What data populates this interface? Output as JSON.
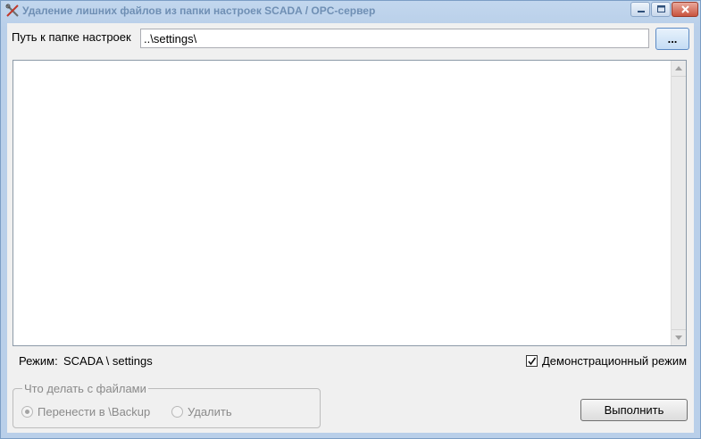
{
  "window": {
    "title": "Удаление лишних файлов из папки настроек SCADA / OPC-сервер",
    "icon": "tools-icon"
  },
  "path": {
    "label": "Путь к папке настроек",
    "value": "..\\settings\\",
    "browse_label": "..."
  },
  "mode": {
    "label": "Режим:",
    "value": "SCADA \\ settings"
  },
  "demo_mode": {
    "label": "Демонстрационный режим",
    "checked": true
  },
  "files_group": {
    "title": "Что делать с файлами",
    "options": [
      {
        "label": "Перенести в \\Backup",
        "selected": true,
        "enabled": false
      },
      {
        "label": "Удалить",
        "selected": false,
        "enabled": false
      }
    ]
  },
  "run_button": {
    "label": "Выполнить"
  },
  "colors": {
    "frame": "#b9cfe9",
    "title_text": "#6f8fb4",
    "close_button": "#c9543f",
    "client_bg": "#f0f0f0"
  }
}
